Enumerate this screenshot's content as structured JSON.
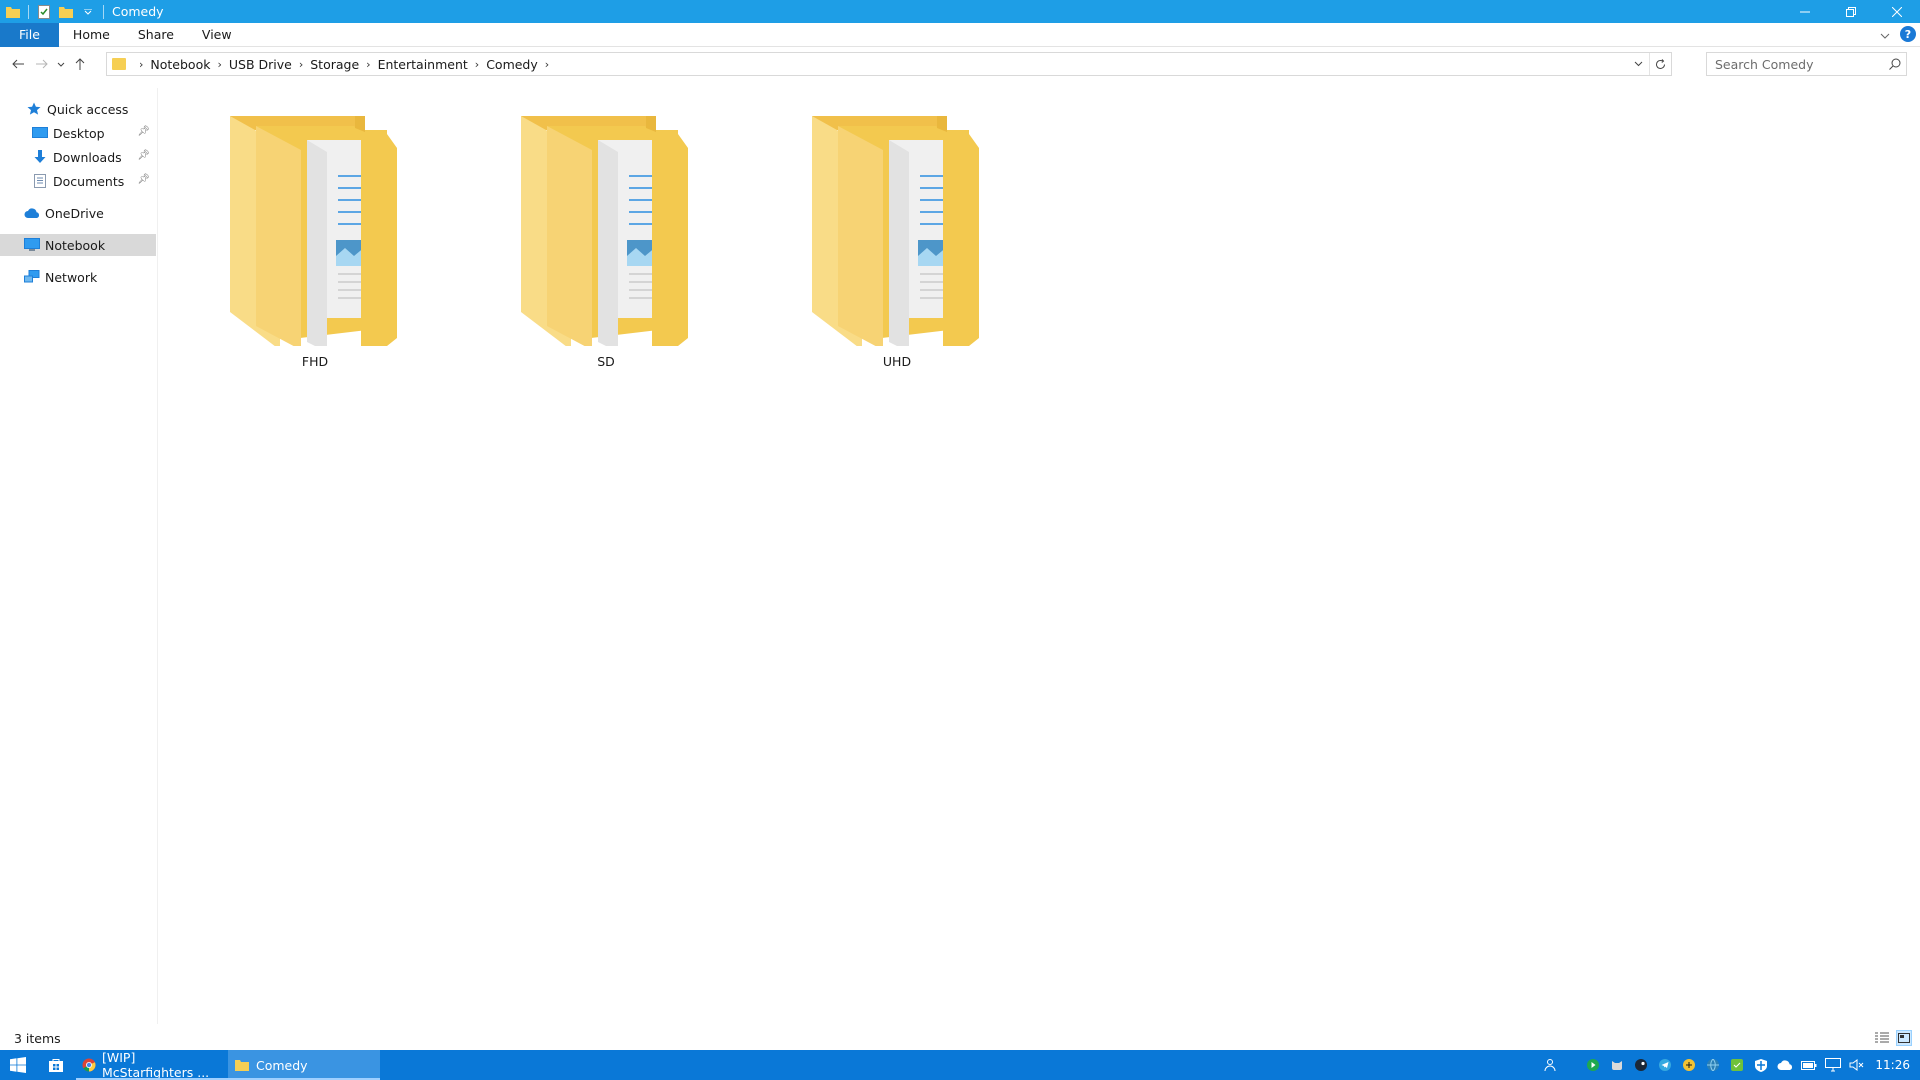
{
  "window": {
    "title": "Comedy",
    "controls": {
      "minimize": "minimize",
      "restore": "restore",
      "close": "close"
    }
  },
  "ribbon": {
    "tabs": [
      {
        "label": "File"
      },
      {
        "label": "Home"
      },
      {
        "label": "Share"
      },
      {
        "label": "View"
      }
    ]
  },
  "address": {
    "breadcrumbs": [
      "Notebook",
      "USB Drive",
      "Storage",
      "Entertainment",
      "Comedy"
    ]
  },
  "search": {
    "placeholder": "Search Comedy"
  },
  "navpane": {
    "quick_access": "Quick access",
    "pinned": [
      {
        "label": "Desktop",
        "icon": "desktop-icon"
      },
      {
        "label": "Downloads",
        "icon": "downloads-icon"
      },
      {
        "label": "Documents",
        "icon": "documents-icon"
      }
    ],
    "onedrive": "OneDrive",
    "notebook": "Notebook",
    "network": "Network"
  },
  "content": {
    "folders": [
      {
        "name": "FHD",
        "icon": "folder-icon"
      },
      {
        "name": "SD",
        "icon": "folder-icon"
      },
      {
        "name": "UHD",
        "icon": "folder-icon"
      }
    ]
  },
  "status": {
    "items_count": "3 items"
  },
  "taskbar": {
    "tasks": [
      {
        "label": "[WIP] McStarfighters ...",
        "icon": "chrome-icon"
      },
      {
        "label": "Comedy",
        "icon": "folder-icon"
      }
    ],
    "clock": "11:26"
  },
  "colors": {
    "titlebar": "#1e9ee6",
    "file_tab": "#1979ca",
    "taskbar": "#0a78d7",
    "folder": "#f6cf54",
    "selected_nav": "#d9d9d9"
  }
}
